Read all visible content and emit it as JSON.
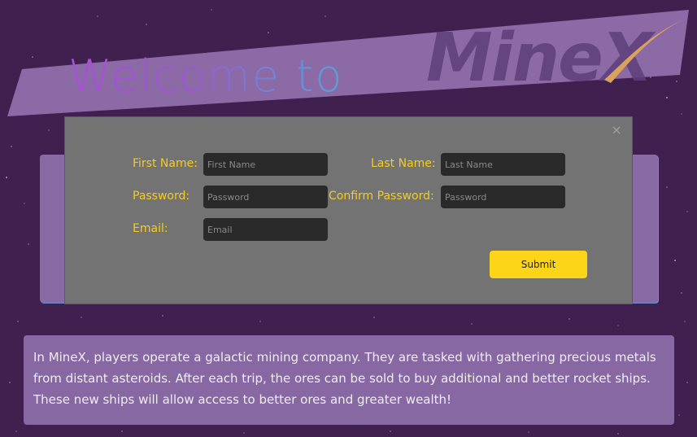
{
  "banner": {
    "welcome_text": "Welcome to",
    "brand_text": "MineX"
  },
  "modal": {
    "close_icon": "×",
    "first_name": {
      "label": "First Name:",
      "placeholder": "First Name"
    },
    "last_name": {
      "label": "Last Name:",
      "placeholder": "Last Name"
    },
    "password": {
      "label": "Password:",
      "placeholder": "Password"
    },
    "confirm_password": {
      "label": "Confirm Password:",
      "placeholder": "Password"
    },
    "email": {
      "label": "Email:",
      "placeholder": "Email"
    },
    "submit_label": "Submit"
  },
  "description": {
    "text": "In MineX, players operate a galactic mining company. They are tasked with gathering precious metals from distant asteroids. After each trip, the ores can be sold to buy additional and better rocket ships. These new ships will allow access to better ores and greater wealth!"
  },
  "colors": {
    "background": "#40204f",
    "label": "#f5cc1f",
    "submit": "#fcd418",
    "modal": "#737373",
    "panel": "#8868a2"
  },
  "icons": {
    "close": "close-icon"
  }
}
